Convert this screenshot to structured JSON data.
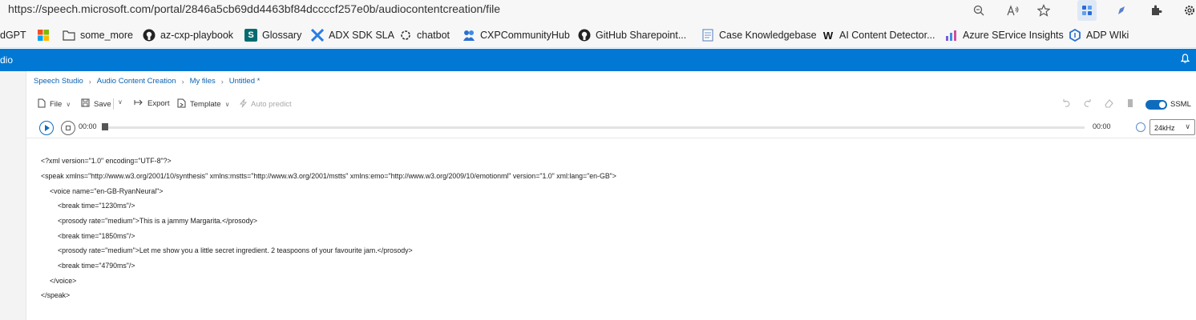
{
  "browser": {
    "url": "https://speech.microsoft.com/portal/2846a5cb69dd4463bf84dccccf257e0b/audiocontentcreation/file"
  },
  "favorites": [
    {
      "label": "dGPT",
      "icon": "none"
    },
    {
      "label": "",
      "icon": "windows-icon"
    },
    {
      "label": "some_more",
      "icon": "folder-icon"
    },
    {
      "label": "az-cxp-playbook",
      "icon": "github-icon"
    },
    {
      "label": "Glossary",
      "icon": "sharepoint-icon"
    },
    {
      "label": "ADX SDK SLA",
      "icon": "adx-icon"
    },
    {
      "label": "chatbot",
      "icon": "openai-icon"
    },
    {
      "label": "CXPCommunityHub",
      "icon": "community-icon"
    },
    {
      "label": "GitHub Sharepoint...",
      "icon": "github-icon"
    },
    {
      "label": "Case Knowledgebase",
      "icon": "doc-icon"
    },
    {
      "label": "AI Content Detector...",
      "icon": "w-icon"
    },
    {
      "label": "Azure SErvice Insights",
      "icon": "insights-icon"
    },
    {
      "label": "ADP WIki",
      "icon": "wiki-icon"
    }
  ],
  "header": {
    "title": "dio"
  },
  "breadcrumb": [
    "Speech Studio",
    "Audio Content Creation",
    "My files",
    "Untitled *"
  ],
  "toolbar": {
    "file": "File",
    "save": "Save",
    "export": "Export",
    "template": "Template",
    "auto_predict": "Auto predict",
    "ssml_label": "SSML",
    "ssml_on": true
  },
  "player": {
    "start_time": "00:00",
    "end_time": "00:00",
    "sample_rate": "24kHz",
    "progress": 0
  },
  "editor": {
    "lines": [
      {
        "indent": 0,
        "text": "<?xml version=\"1.0\" encoding=\"UTF-8\"?>"
      },
      {
        "indent": 0,
        "text": "<speak xmlns=\"http://www.w3.org/2001/10/synthesis\" xmlns:mstts=\"http://www.w3.org/2001/mstts\" xmlns:emo=\"http://www.w3.org/2009/10/emotionml\" version=\"1.0\" xml:lang=\"en-GB\">"
      },
      {
        "indent": 1,
        "text": "<voice name=\"en-GB-RyanNeural\">"
      },
      {
        "indent": 2,
        "text": "<break time=\"1230ms\"/>"
      },
      {
        "indent": 2,
        "text": "<prosody rate=\"medium\">This is a jammy Margarita.</prosody>"
      },
      {
        "indent": 2,
        "text": "<break time=\"1850ms\"/>"
      },
      {
        "indent": 2,
        "text": "<prosody rate=\"medium\">Let me show you a little secret ingredient. 2 teaspoons of your favourite jam.</prosody>"
      },
      {
        "indent": 2,
        "text": "<break time=\"4790ms\"/>"
      },
      {
        "indent": 1,
        "text": "</voice>"
      },
      {
        "indent": 0,
        "text": "</speak>"
      }
    ]
  }
}
